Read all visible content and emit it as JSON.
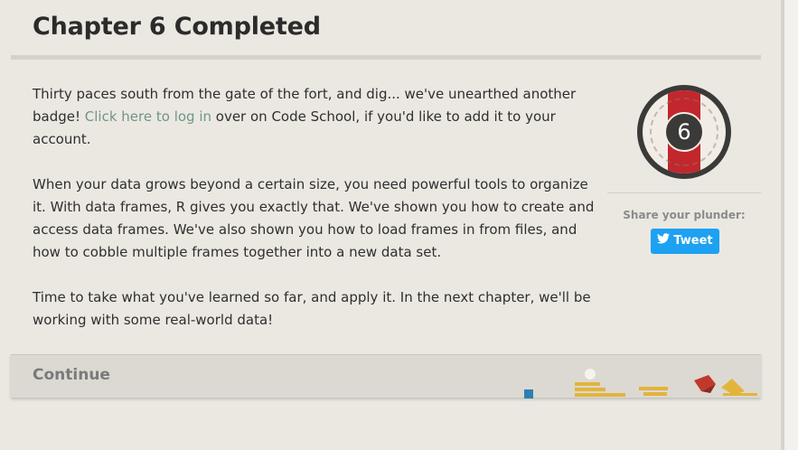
{
  "chapter": {
    "title": "Chapter 6 Completed",
    "intro_before_link": "Thirty paces south from the gate of the fort, and dig... we've unearthed another badge! ",
    "login_link": "Click here to log in",
    "intro_after_link": " over on Code School, if you'd like to add it to your account.",
    "paragraph2": "When your data grows beyond a certain size, you need powerful tools to organize it. With data frames, R gives you exactly that. We've shown you how to create and access data frames. We've also shown you how to load frames in from files, and how to cobble multiple frames together into a new data set.",
    "paragraph3": "Time to take what you've learned so far, and apply it. In the next chapter, we'll be working with some real-world data!"
  },
  "badge": {
    "number": "6",
    "icon": "chapter-badge",
    "accent_color": "#c1272d"
  },
  "share": {
    "label": "Share your plunder:",
    "tweet_label": "Tweet",
    "tweet_icon": "twitter-bird-icon",
    "tweet_color": "#1da1f2"
  },
  "footer": {
    "continue_label": "Continue"
  }
}
